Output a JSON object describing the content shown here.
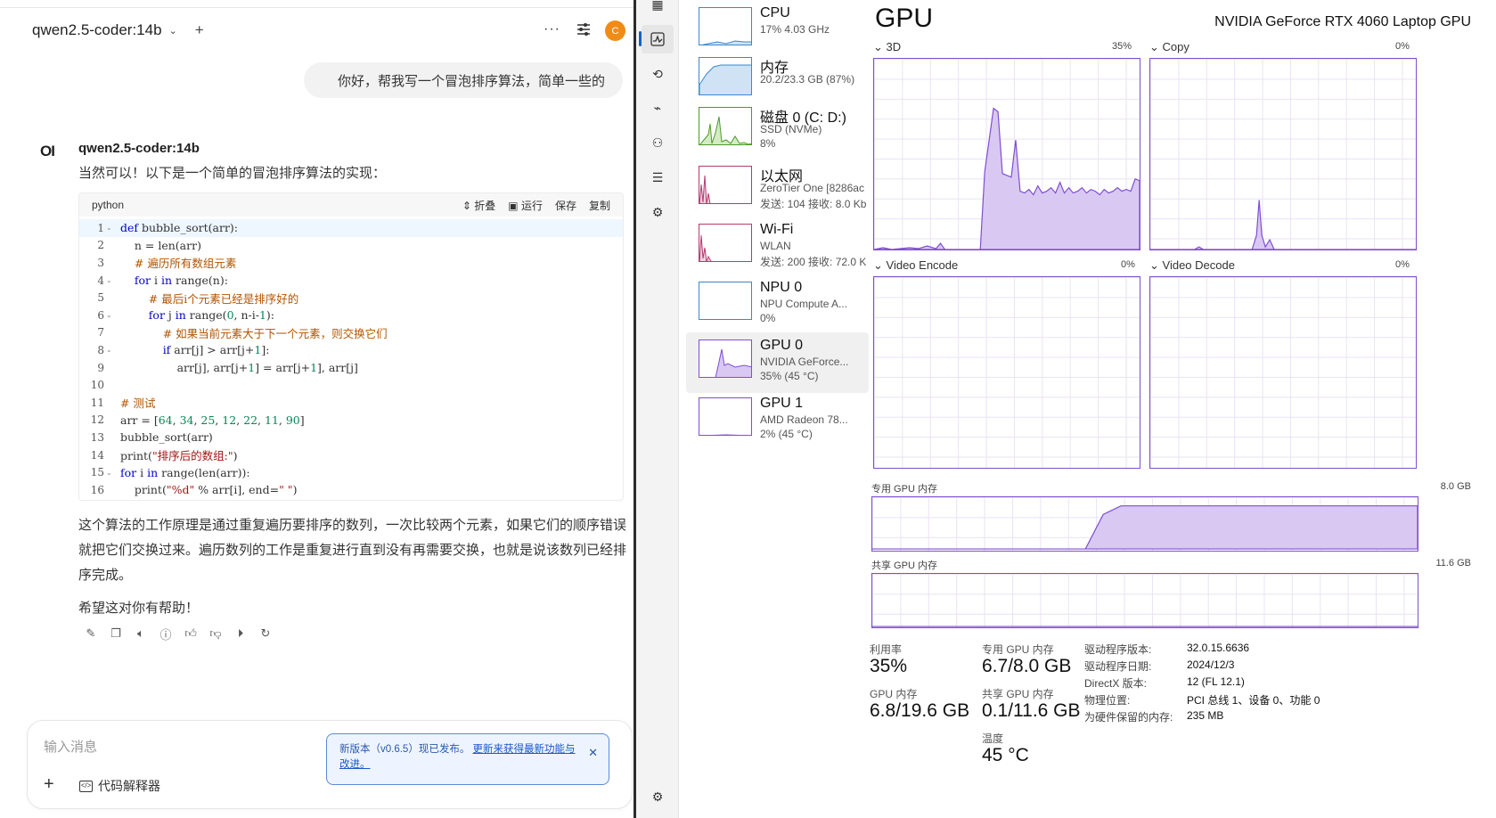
{
  "chat": {
    "model": "qwen2.5-coder:14b",
    "avatar_initial": "C",
    "user_message": "你好，帮我写一个冒泡排序算法，简单一些的",
    "ai_logo": "OI",
    "ai_name": "qwen2.5-coder:14b",
    "ai_intro": "当然可以！以下是一个简单的冒泡排序算法的实现：",
    "code_lang": "python",
    "code_actions": {
      "collapse": "折叠",
      "run": "运行",
      "save": "保存",
      "copy": "复制"
    },
    "code_lines": [
      {
        "n": "1",
        "fold": true
      },
      {
        "n": "2",
        "fold": false
      },
      {
        "n": "3",
        "fold": false
      },
      {
        "n": "4",
        "fold": true
      },
      {
        "n": "5",
        "fold": false
      },
      {
        "n": "6",
        "fold": true
      },
      {
        "n": "7",
        "fold": false
      },
      {
        "n": "8",
        "fold": true
      },
      {
        "n": "9",
        "fold": false
      },
      {
        "n": "10",
        "fold": false
      },
      {
        "n": "11",
        "fold": false
      },
      {
        "n": "12",
        "fold": false
      },
      {
        "n": "13",
        "fold": false
      },
      {
        "n": "14",
        "fold": false
      },
      {
        "n": "15",
        "fold": true
      },
      {
        "n": "16",
        "fold": false
      }
    ],
    "code_text": [
      "def bubble_sort(arr):",
      "    n = len(arr)",
      "    # 遍历所有数组元素",
      "    for i in range(n):",
      "        # 最后i个元素已经是排序好的",
      "        for j in range(0, n-i-1):",
      "            # 如果当前元素大于下一个元素，则交换它们",
      "            if arr[j] > arr[j+1]:",
      "                arr[j], arr[j+1] = arr[j+1], arr[j]",
      "",
      "# 测试",
      "arr = [64, 34, 25, 12, 22, 11, 90]",
      "bubble_sort(arr)",
      "print(\"排序后的数组:\")",
      "for i in range(len(arr)):",
      "    print(\"%d\" % arr[i], end=\" \")"
    ],
    "explain": "这个算法的工作原理是通过重复遍历要排序的数列，一次比较两个元素，如果它们的顺序错误就把它们交换过来。遍历数列的工作是重复进行直到没有再需要交换，也就是说该数列已经排序完成。",
    "thanks": "希望这对你有帮助！",
    "input_placeholder": "输入消息",
    "code_interpreter": "代码解释器",
    "toast_text": "新版本（v0.6.5）现已发布。",
    "toast_link": "更新来获得最新功能与改进。"
  },
  "taskmgr": {
    "resources": [
      {
        "title": "CPU",
        "sub1": "17% 4.03 GHz",
        "sub2": ""
      },
      {
        "title": "内存",
        "sub1": "20.2/23.3 GB (87%)",
        "sub2": ""
      },
      {
        "title": "磁盘 0 (C: D:)",
        "sub1": "SSD (NVMe)",
        "sub2": "8%"
      },
      {
        "title": "以太网",
        "sub1": "ZeroTier One [8286ac",
        "sub2": "发送: 104 接收: 8.0 Kb"
      },
      {
        "title": "Wi-Fi",
        "sub1": "WLAN",
        "sub2": "发送: 200 接收: 72.0 K"
      },
      {
        "title": "NPU 0",
        "sub1": "NPU Compute A...",
        "sub2": "0%"
      },
      {
        "title": "GPU 0",
        "sub1": "NVIDIA GeForce...",
        "sub2": "35% (45 °C)"
      },
      {
        "title": "GPU 1",
        "sub1": "AMD Radeon 78...",
        "sub2": "2% (45 °C)"
      }
    ],
    "gpu_title": "GPU",
    "gpu_model": "NVIDIA GeForce RTX 4060 Laptop GPU",
    "graphs": {
      "g3d": {
        "label": "3D",
        "pct": "35%"
      },
      "copy": {
        "label": "Copy",
        "pct": "0%"
      },
      "venc": {
        "label": "Video Encode",
        "pct": "0%"
      },
      "vdec": {
        "label": "Video Decode",
        "pct": "0%"
      }
    },
    "dedicated_label": "专用 GPU 内存",
    "dedicated_max": "8.0 GB",
    "shared_label": "共享 GPU 内存",
    "shared_max": "11.6 GB",
    "stats": {
      "util_label": "利用率",
      "util_value": "35%",
      "ded_label": "专用 GPU 内存",
      "ded_value": "6.7/8.0 GB",
      "gpumem_label": "GPU 内存",
      "gpumem_value": "6.8/19.6 GB",
      "shared_label": "共享 GPU 内存",
      "shared_value": "0.1/11.6 GB",
      "temp_label": "温度",
      "temp_value": "45 °C"
    },
    "info": [
      {
        "k": "驱动程序版本:",
        "v": "32.0.15.6636"
      },
      {
        "k": "驱动程序日期:",
        "v": "2024/12/3"
      },
      {
        "k": "DirectX 版本:",
        "v": "12 (FL 12.1)"
      },
      {
        "k": "物理位置:",
        "v": "PCI 总线 1、设备 0、功能 0"
      },
      {
        "k": "为硬件保留的内存:",
        "v": "235 MB"
      }
    ],
    "colors": {
      "gpu": "#7e4ed0",
      "gpu_fill": "#d9c9f2",
      "cpu": "#3d87c9",
      "disk": "#4c9a2a",
      "net": "#b33b6f"
    }
  }
}
